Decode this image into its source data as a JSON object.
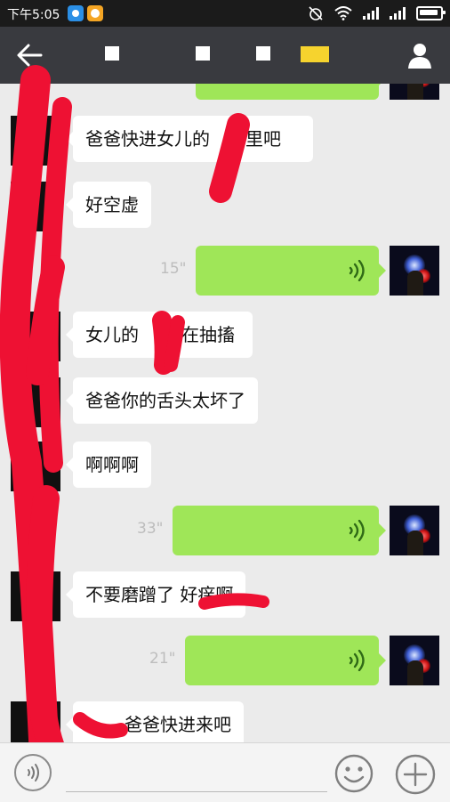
{
  "status_bar": {
    "time": "下午5:05"
  },
  "chat": {
    "messages": [
      {
        "side": "left",
        "type": "text",
        "text": "爸爸快进女儿的",
        "trail": "里吧"
      },
      {
        "side": "left",
        "type": "text",
        "text": "好空虚"
      },
      {
        "side": "right",
        "type": "voice",
        "duration": "15\""
      },
      {
        "side": "left",
        "type": "text",
        "text": "女儿的",
        "trail": "在抽搐"
      },
      {
        "side": "left",
        "type": "text",
        "text": "爸爸你的舌头太坏了"
      },
      {
        "side": "left",
        "type": "text",
        "text": "啊啊啊"
      },
      {
        "side": "right",
        "type": "voice",
        "duration": "33\""
      },
      {
        "side": "left",
        "type": "text",
        "text": "不要磨蹭了 好痒啊"
      },
      {
        "side": "right",
        "type": "voice",
        "duration": "21\""
      },
      {
        "side": "left",
        "type": "text",
        "text": "爸爸快进来吧"
      }
    ]
  },
  "icons": {
    "back": "arrow-left-icon",
    "profile": "person-icon",
    "voice": "voice-wave-icon",
    "emoji": "smiley-icon",
    "plus": "plus-icon"
  },
  "colors": {
    "title_bar": "#393a3f",
    "voice_bubble": "#9fe658",
    "redaction": "#ee1133"
  }
}
